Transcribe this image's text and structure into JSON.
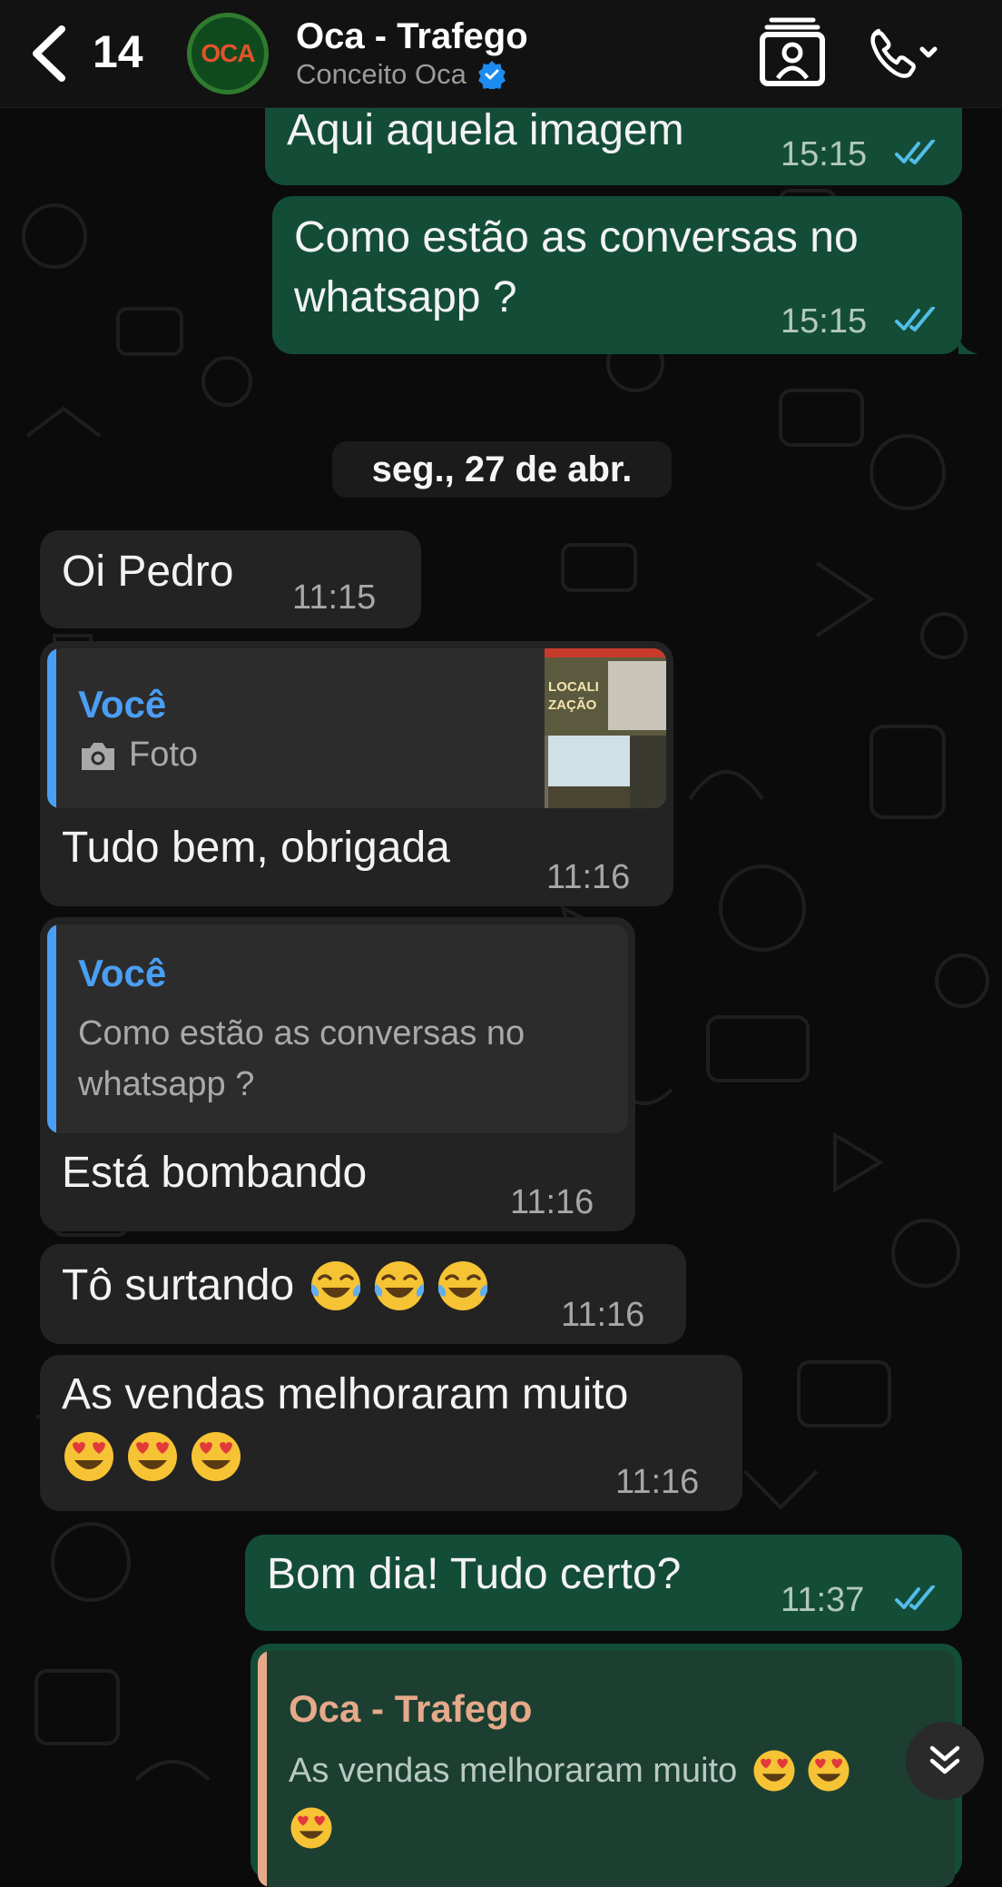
{
  "header": {
    "back_count": "14",
    "avatar_text": "OCA",
    "title": "Oca - Trafego",
    "subtitle": "Conceito Oca"
  },
  "messages": {
    "m1": {
      "text": "Aqui aquela imagem",
      "time": "15:15"
    },
    "m2": {
      "text1": "Como estão as conversas no",
      "text2": "whatsapp ?",
      "time": "15:15"
    },
    "date_separator": "seg., 27 de abr.",
    "m3": {
      "text": "Oi Pedro",
      "time": "11:15"
    },
    "m4": {
      "quote_name": "Você",
      "quote_type": "Foto",
      "thumb_text1": "LOCALI",
      "thumb_text2": "ZAÇÃO",
      "text": "Tudo bem, obrigada",
      "time": "11:16"
    },
    "m5": {
      "quote_name": "Você",
      "quote_line1": "Como estão as conversas no",
      "quote_line2": "whatsapp ?",
      "text": "Está bombando",
      "time": "11:16"
    },
    "m6": {
      "text": "Tô surtando",
      "time": "11:16"
    },
    "m7": {
      "text": "As vendas melhoraram muito",
      "time": "11:16"
    },
    "m8": {
      "text": "Bom dia! Tudo certo?",
      "time": "11:37"
    },
    "m9": {
      "quote_name": "Oca - Trafego",
      "quote_text": "As vendas melhoraram muito"
    }
  },
  "icons": {
    "back": "chevron-left-icon",
    "contact": "contact-card-icon",
    "call": "phone-icon",
    "verified": "verified-badge-icon",
    "camera": "camera-icon",
    "read_receipt": "double-check-icon",
    "laugh": "tears-of-joy-emoji",
    "love": "heart-eyes-emoji",
    "scroll_down": "double-chevron-down-icon"
  },
  "colors": {
    "outgoing_bubble": "#144d37",
    "incoming_bubble": "#232323",
    "read_tick": "#53bdeb",
    "quote_you": "#4a9ff5",
    "quote_contact": "#e6a98a"
  }
}
